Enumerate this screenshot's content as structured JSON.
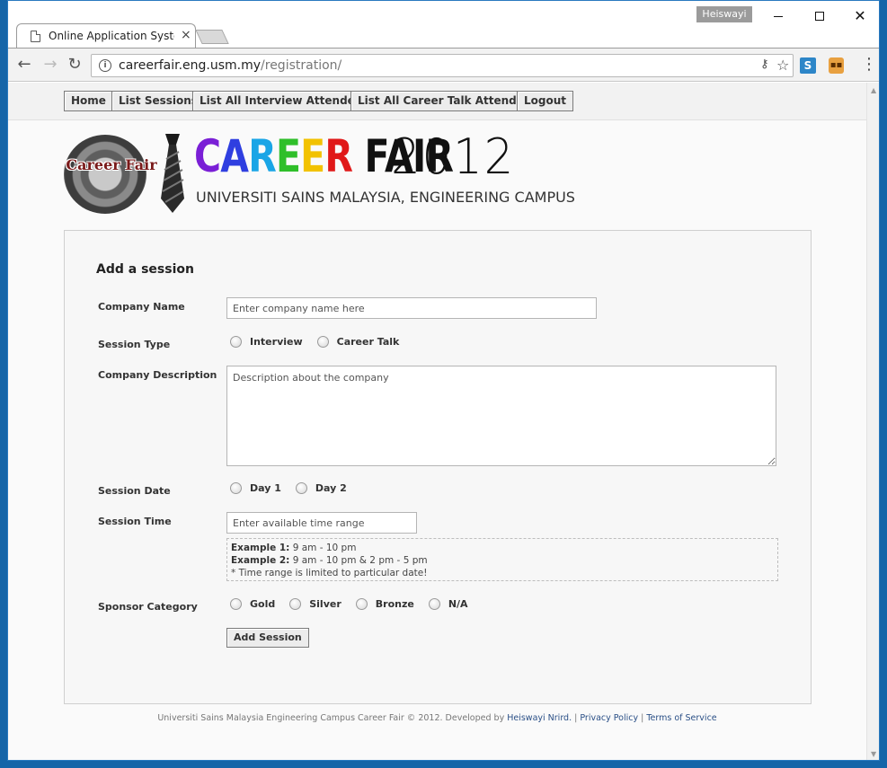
{
  "browser": {
    "tab_title": "Online Application System",
    "tab_close": "×",
    "user_badge": "Heiswayi",
    "url_host": "careerfair.eng.usm.my",
    "url_path": "/registration/",
    "nav_back": "←",
    "nav_forward": "→",
    "nav_reload": "↻",
    "star": "☆",
    "menu": "⋮"
  },
  "nav": {
    "home": "Home",
    "list_sessions": "List Sessions",
    "list_interview": "List All Interview Attendees",
    "list_career_talk": "List All Career Talk Attendees",
    "logout": "Logout"
  },
  "banner": {
    "seal_text": "Career Fair",
    "title_letters": [
      {
        "ch": "C",
        "color": "#7a1fd6"
      },
      {
        "ch": "A",
        "color": "#2f3fe0"
      },
      {
        "ch": "R",
        "color": "#1aa5e6"
      },
      {
        "ch": "E",
        "color": "#2fbf2a"
      },
      {
        "ch": "E",
        "color": "#f2c200"
      },
      {
        "ch": "R",
        "color": "#e01919"
      },
      {
        "ch": " ",
        "color": "#111111"
      },
      {
        "ch": "F",
        "color": "#111111"
      },
      {
        "ch": "A",
        "color": "#111111"
      },
      {
        "ch": "I",
        "color": "#111111"
      },
      {
        "ch": "R",
        "color": "#111111"
      }
    ],
    "year": "2012",
    "subtitle": "UNIVERSITI SAINS MALAYSIA, ENGINEERING CAMPUS"
  },
  "form": {
    "title": "Add a session",
    "company_name_label": "Company Name",
    "company_name_placeholder": "Enter company name here",
    "session_type_label": "Session Type",
    "session_type_options": [
      "Interview",
      "Career Talk"
    ],
    "company_desc_label": "Company Description",
    "company_desc_placeholder": "Description about the company",
    "session_date_label": "Session Date",
    "session_date_options": [
      "Day 1",
      "Day 2"
    ],
    "session_time_label": "Session Time",
    "session_time_placeholder": "Enter available time range",
    "hint": {
      "ex1_label": "Example 1:",
      "ex1_value": " 9 am - 10 pm",
      "ex2_label": "Example 2:",
      "ex2_value": " 9 am - 10 pm & 2 pm - 5 pm",
      "note": "* Time range is limited to particular date!"
    },
    "sponsor_label": "Sponsor Category",
    "sponsor_options": [
      "Gold",
      "Silver",
      "Bronze",
      "N/A"
    ],
    "submit_label": "Add Session"
  },
  "footer": {
    "text": "Universiti Sains Malaysia Engineering Campus Career Fair © 2012. Developed by ",
    "developer": "Heiswayi Nrird.",
    "sep1": " | ",
    "privacy": "Privacy Policy",
    "sep2": " | ",
    "terms": "Terms of Service"
  },
  "colors": {
    "accent_link": "#2a4f86",
    "desktop": "#1565a8"
  }
}
